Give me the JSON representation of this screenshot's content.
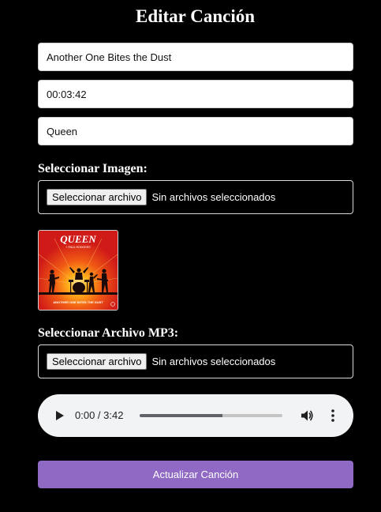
{
  "page": {
    "title": "Editar Canción"
  },
  "form": {
    "song_name": "Another One Bites the Dust",
    "duration": "00:03:42",
    "artist": "Queen",
    "image_section_label": "Seleccionar Imagen:",
    "image_picker": {
      "button_label": "Seleccionar archivo",
      "status": "Sin archivos seleccionados"
    },
    "cover_art": {
      "band_logo": "QUEEN",
      "subtitle": "+ PAUL RODGERS",
      "footer": "ANOTHER ONE BITES THE DUST"
    },
    "mp3_section_label": "Seleccionar Archivo MP3:",
    "mp3_picker": {
      "button_label": "Seleccionar archivo",
      "status": "Sin archivos seleccionados"
    },
    "audio_player": {
      "time_display": "0:00 / 3:42",
      "progress_fraction": 0.58,
      "icons": [
        "play-icon",
        "volume-icon",
        "more-options-icon"
      ]
    },
    "submit_label": "Actualizar Canción"
  },
  "colors": {
    "background": "#000000",
    "text": "#ffffff",
    "accent_button": "#8f69c4",
    "player_background": "#f1f3f4",
    "cover_red": "#d8201a"
  }
}
